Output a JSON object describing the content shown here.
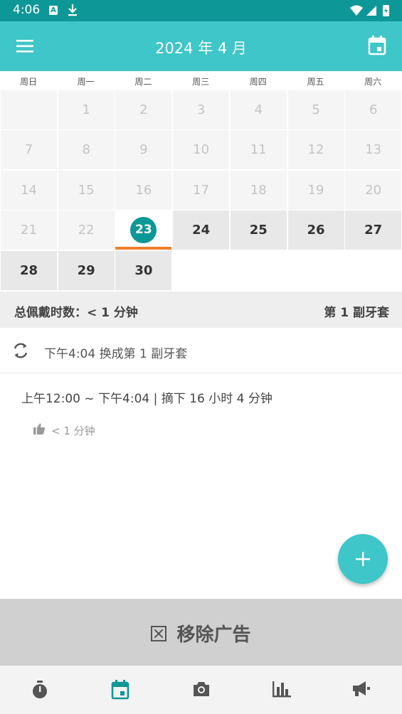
{
  "status_bar": {
    "time": "4:06",
    "a_badge": "A"
  },
  "app_bar": {
    "title": "2024 年 4 月"
  },
  "weekdays": [
    "周日",
    "周一",
    "周二",
    "周三",
    "周四",
    "周五",
    "周六"
  ],
  "calendar": {
    "days": [
      "1",
      "2",
      "3",
      "4",
      "5",
      "6",
      "7",
      "8",
      "9",
      "10",
      "11",
      "12",
      "13",
      "14",
      "15",
      "16",
      "17",
      "18",
      "19",
      "20",
      "21",
      "22",
      "23",
      "24",
      "25",
      "26",
      "27",
      "28",
      "29",
      "30"
    ],
    "today": "23"
  },
  "summary": {
    "left": "总佩戴时数：< 1 分钟",
    "right": "第 1 副牙套"
  },
  "event": {
    "text": "下午4:04 换成第 1 副牙套"
  },
  "record": {
    "text": "上午12:00 ~ 下午4:04 | 摘下 16 小时 4 分钟",
    "duration": "< 1 分钟"
  },
  "ad": {
    "label": "移除广告"
  },
  "icons": {
    "menu": "menu-icon",
    "calendar": "calendar-icon",
    "swap": "swap-icon",
    "thumb": "thumb-up-icon",
    "timer": "timer-icon",
    "camera": "camera-icon",
    "chart": "bar-chart-icon",
    "megaphone": "megaphone-icon"
  },
  "colors": {
    "primary": "#3ec6c8",
    "dark": "#0e9797",
    "today_underline": "#f07d2a"
  }
}
